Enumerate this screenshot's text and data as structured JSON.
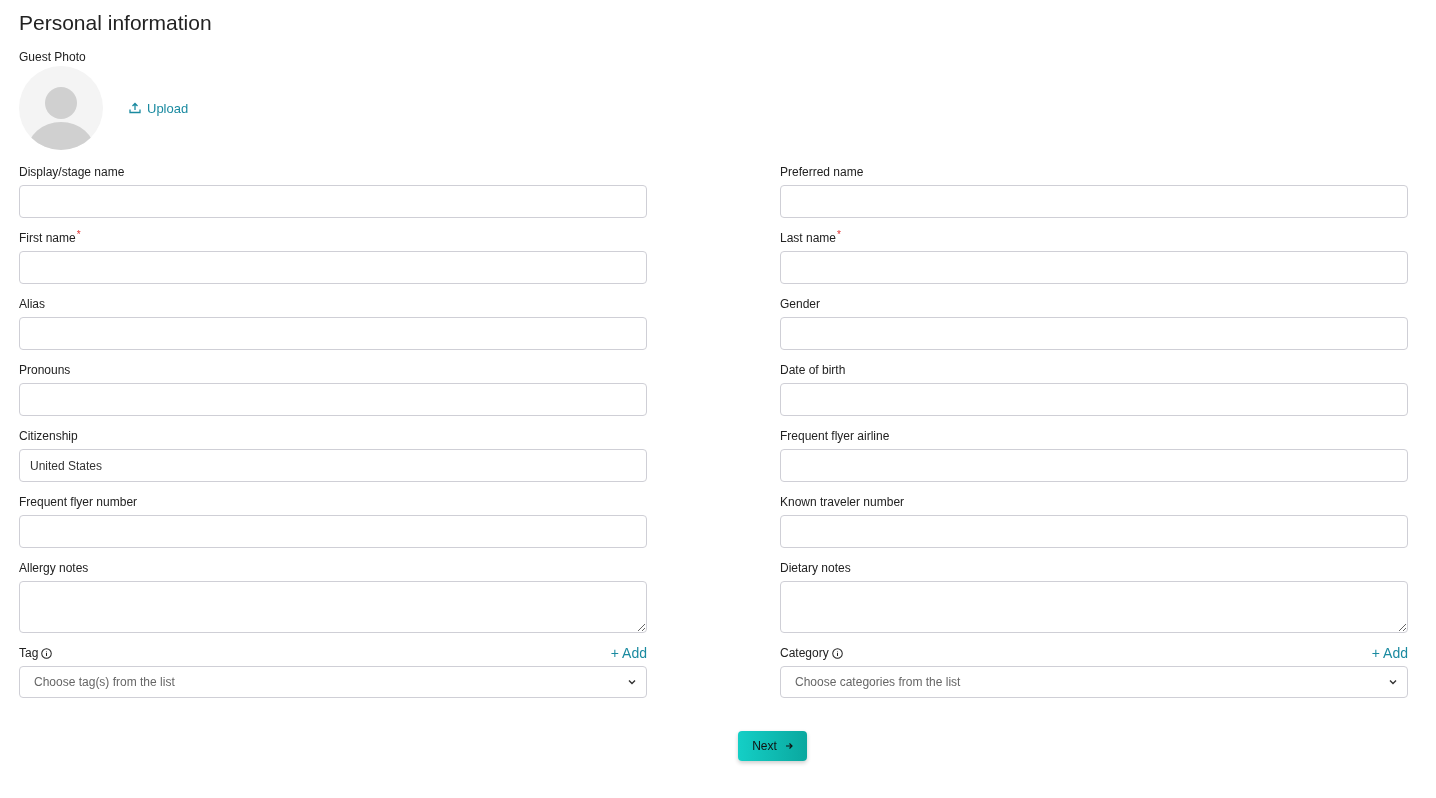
{
  "title": "Personal information",
  "photo": {
    "label": "Guest Photo",
    "upload": "Upload"
  },
  "fields": [
    {
      "label": "Display/stage name",
      "kind": "input"
    },
    {
      "label": "Preferred name",
      "kind": "input"
    },
    {
      "label": "First name",
      "kind": "input",
      "required_mark": "*"
    },
    {
      "label": "Last name",
      "kind": "input",
      "required_mark": "*"
    },
    {
      "label": "Alias",
      "kind": "input"
    },
    {
      "label": "Gender",
      "kind": "input"
    },
    {
      "label": "Pronouns",
      "kind": "input"
    },
    {
      "label": "Date of birth",
      "kind": "input"
    },
    {
      "label": "Citizenship",
      "kind": "input",
      "value": "United States"
    },
    {
      "label": "Frequent flyer airline",
      "kind": "input"
    },
    {
      "label": "Frequent flyer number",
      "kind": "input"
    },
    {
      "label": "Known traveler number",
      "kind": "input"
    },
    {
      "label": "Allergy notes",
      "kind": "textarea"
    },
    {
      "label": "Dietary notes",
      "kind": "textarea"
    },
    {
      "label": "Tag",
      "kind": "select",
      "info": true,
      "add": "+ Add",
      "placeholder": "Choose tag(s) from the list"
    },
    {
      "label": "Category",
      "kind": "select",
      "info": true,
      "add": "+ Add",
      "placeholder": "Choose categories from the list"
    }
  ],
  "next_button": "Next"
}
